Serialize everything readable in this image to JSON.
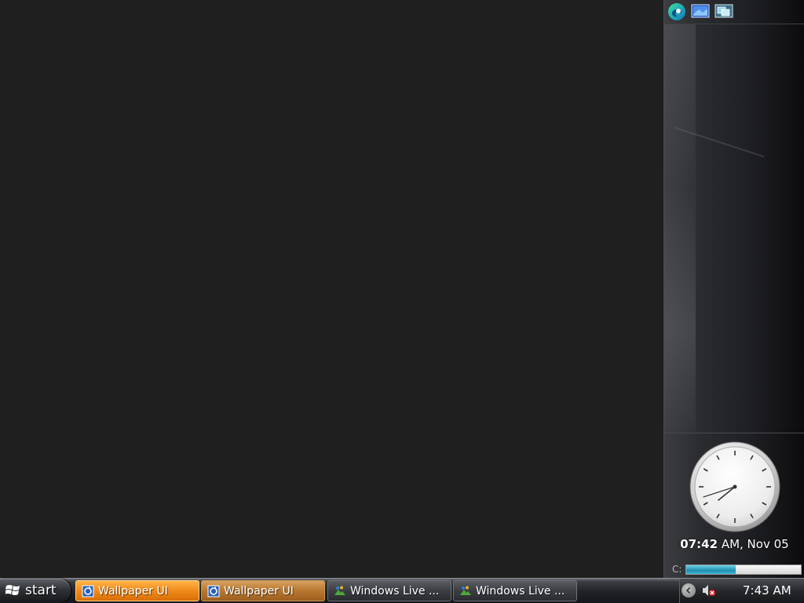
{
  "sidebar": {
    "toolbar_icons": [
      "edge-browser-icon",
      "show-desktop-icon",
      "switch-windows-icon"
    ],
    "clock": {
      "time_bold": "07:42",
      "time_rest": " AM, Nov 05",
      "hour": 7,
      "minute": 42
    },
    "drive": {
      "label": "C:",
      "used_fraction": 0.43
    }
  },
  "taskbar": {
    "start_label": "start",
    "buttons": [
      {
        "label": "Wallpaper UI",
        "icon": "wallpaper-app-icon",
        "state": "active"
      },
      {
        "label": "Wallpaper UI",
        "icon": "wallpaper-app-icon",
        "state": "inactive"
      },
      {
        "label": "Windows Live ...",
        "icon": "windows-live-icon",
        "state": "inactive"
      },
      {
        "label": "Windows Live ...",
        "icon": "windows-live-icon",
        "state": "inactive"
      }
    ],
    "tray": {
      "time": "7:43 AM",
      "icons": [
        "show-hidden-icons-chevron-icon",
        "volume-muted-icon"
      ]
    }
  },
  "colors": {
    "desktop_bg": "#1f1f1f",
    "active_task": "#f08a1a",
    "inactive_task": "#b8772e",
    "drive_fill": "#1f8fb0"
  }
}
